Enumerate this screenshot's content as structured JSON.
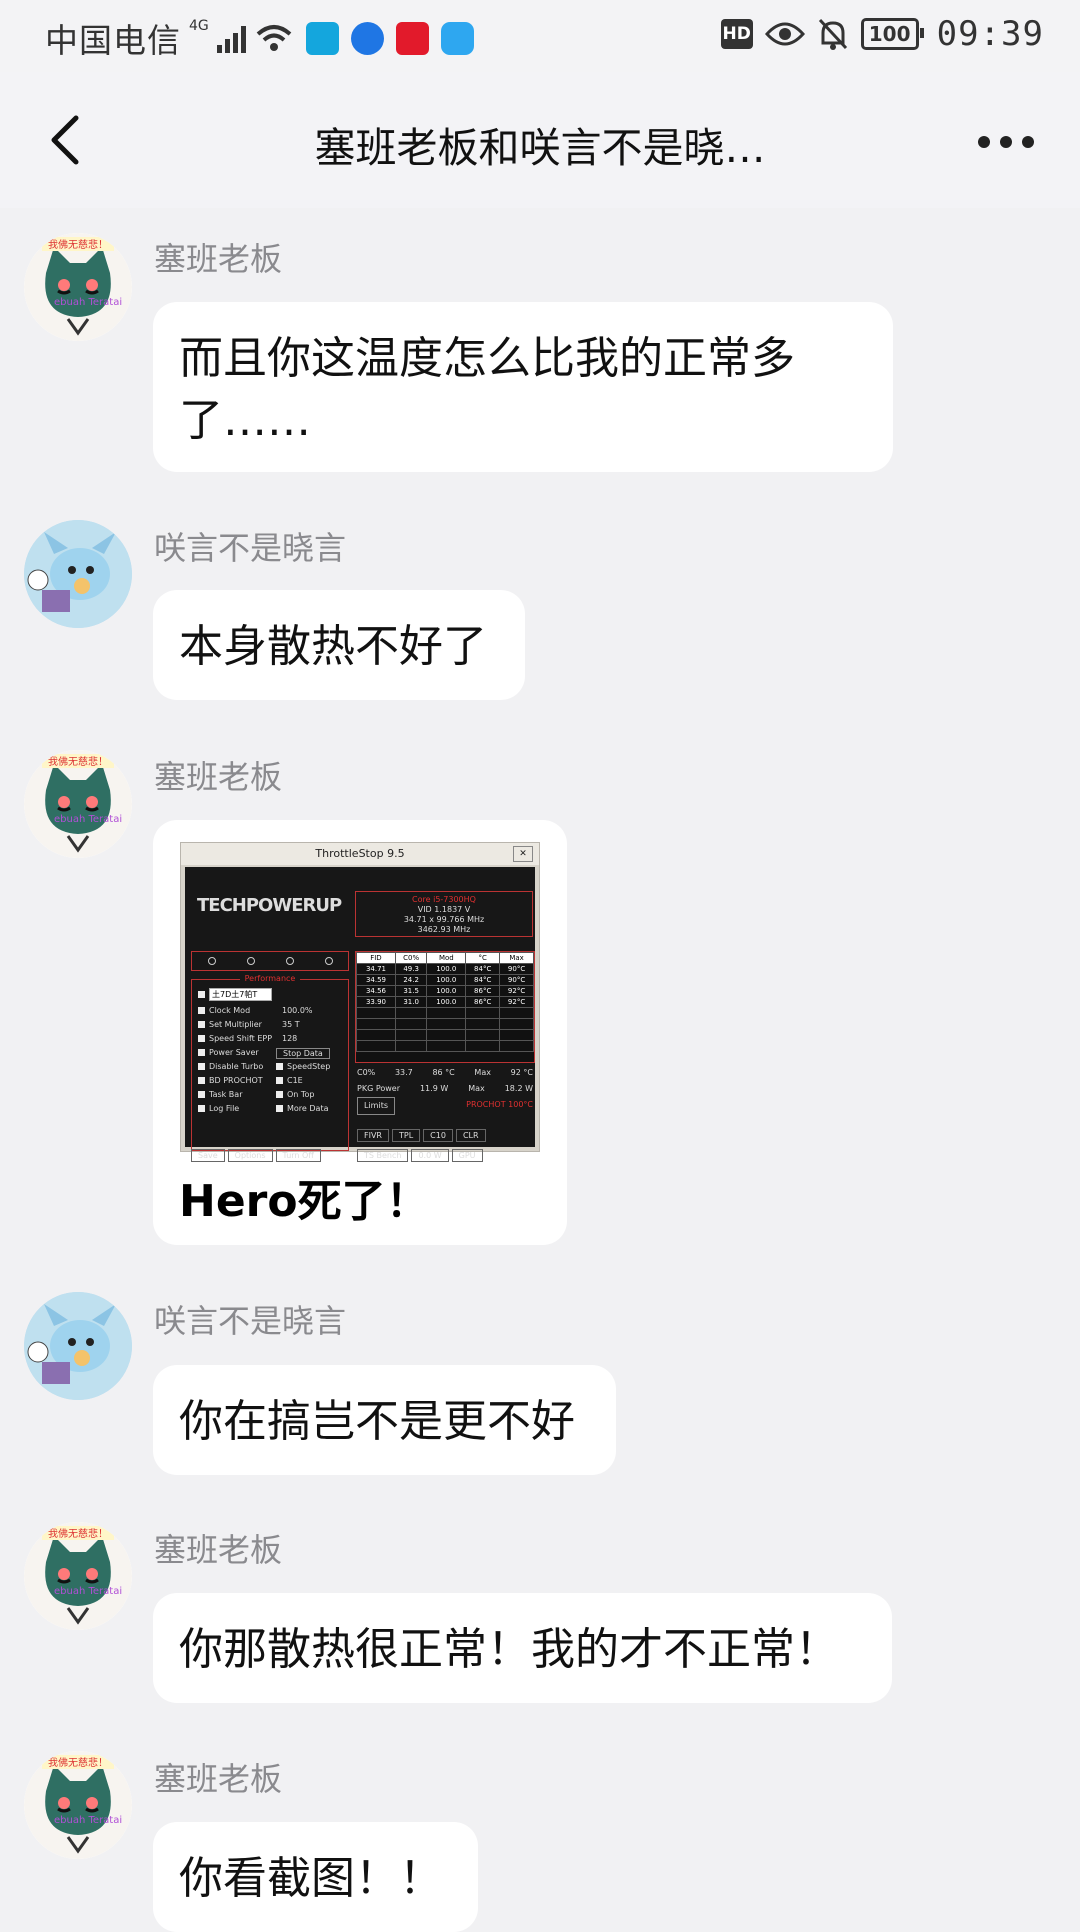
{
  "status_bar": {
    "carrier": "中国电信",
    "network": "4G",
    "battery": "100",
    "time": "09:39",
    "hd_label": "HD"
  },
  "header": {
    "title": "塞班老板和咲言不是晓…"
  },
  "messages": [
    {
      "sender": "塞班老板",
      "text": "而且你这温度怎么比我的正常多了……",
      "line1": "而且你这温度怎么比我的正常多",
      "line2": "了……"
    },
    {
      "sender": "咲言不是晓言",
      "text": "本身散热不好了"
    },
    {
      "sender": "塞班老板",
      "text": "Hero死了！"
    },
    {
      "sender": "咲言不是晓言",
      "text": "你在搞岂不是更不好"
    },
    {
      "sender": "塞班老板",
      "text": "你那散热很正常！我的才不正常！"
    },
    {
      "sender": "塞班老板",
      "text": "你看截图！！"
    }
  ],
  "avatar_badges": {
    "top": "我佛无慈悲！",
    "bottom": "ebuah Teratai"
  },
  "screenshot": {
    "window_title": "ThrottleStop 9.5",
    "logo": "TECHPOWERUP",
    "cpu": "Core i5-7300HQ",
    "vid": "VID  1.1837 V",
    "multiplier": "34.71 x 99.766 MHz",
    "freq": "3462.93 MHz",
    "perf_title": "Performance",
    "profile_value": "土7D土7帕T",
    "options": [
      "Clock Mod",
      "Set Multiplier",
      "Speed Shift EPP",
      "Power Saver",
      "Disable Turbo",
      "BD PROCHOT",
      "Task Bar",
      "Log File"
    ],
    "option_values": [
      "100.0%",
      "35 T",
      "128"
    ],
    "right_options": [
      "SpeedStep",
      "C1E",
      "On Top",
      "More Data"
    ],
    "stop_data": "Stop Data",
    "table_header": [
      "FID",
      "C0%",
      "Mod",
      "°C",
      "Max"
    ],
    "table_rows": [
      [
        "34.71",
        "49.3",
        "100.0",
        "84°C",
        "90°C"
      ],
      [
        "34.59",
        "24.2",
        "100.0",
        "84°C",
        "90°C"
      ],
      [
        "34.56",
        "31.5",
        "100.0",
        "86°C",
        "92°C"
      ],
      [
        "33.90",
        "31.0",
        "100.0",
        "86°C",
        "92°C"
      ]
    ],
    "c0_label": "C0%",
    "c0_value": "33.7",
    "temp_value": "86 °C",
    "max_label": "Max",
    "max_temp": "92 °C",
    "pkg_label": "PKG Power",
    "pkg_value": "11.9 W",
    "pkg_max": "18.2 W",
    "limits": "Limits",
    "prochot": "PROCHOT 100°C",
    "buttons_right": [
      "FIVR",
      "TPL",
      "C10",
      "CLR"
    ],
    "buttons_bottom_left": [
      "Save",
      "Options",
      "Turn Off"
    ],
    "buttons_bottom_right": [
      "TS Bench",
      "0.0 W",
      "GPU"
    ]
  }
}
